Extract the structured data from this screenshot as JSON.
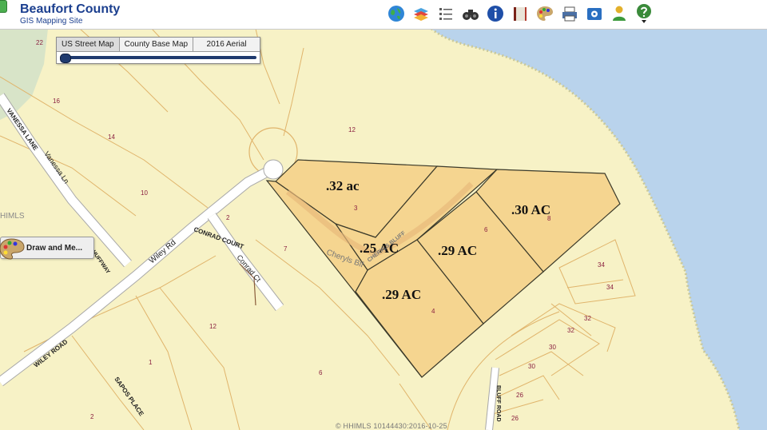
{
  "header": {
    "title": "Beaufort County",
    "subtitle": "GIS Mapping Site"
  },
  "toolbar": {
    "tools": [
      "globe-icon",
      "layers-icon",
      "list-icon",
      "binoculars-icon",
      "info-icon",
      "book-icon",
      "palette-icon",
      "print-icon",
      "settings-icon",
      "user-icon",
      "help-icon"
    ]
  },
  "basemap": {
    "options": [
      "US Street Map",
      "County Base Map",
      "2016 Aerial"
    ],
    "selected": "US Street Map",
    "opacity": 0
  },
  "draw_button": {
    "label": "Draw and Me..."
  },
  "map": {
    "parcel_labels": [
      ".32 ac",
      ".25 AC",
      ".29 AC",
      ".30 AC",
      ".29 AC"
    ],
    "street_labels": [
      "VANESSA LANE",
      "Vanessa Ln",
      "Wiley Rd",
      "CONRAD COURT",
      "Conrad Ct",
      "WILEY ROAD",
      "SAPOS PLACE",
      "Cheryls Blf",
      "CHERYLS BLUFF",
      "HUFFWAY",
      "BLUFF ROAD"
    ],
    "lot_numbers": [
      "22",
      "16",
      "14",
      "10",
      "12",
      "7",
      "12",
      "1",
      "2",
      "6",
      "3",
      "4",
      "6",
      "8",
      "34",
      "34",
      "32",
      "32",
      "30",
      "30",
      "26",
      "26",
      "2"
    ],
    "area_label": "HIMLS",
    "colors": {
      "land": "#f7f2c6",
      "water": "#b9d3ec",
      "parcel_fill": "#f5d590",
      "parcel_line": "#3b3a2a",
      "lot_line": "#e0b46b"
    }
  },
  "watermark": "© HHIMLS 10144430:2016-10-25"
}
